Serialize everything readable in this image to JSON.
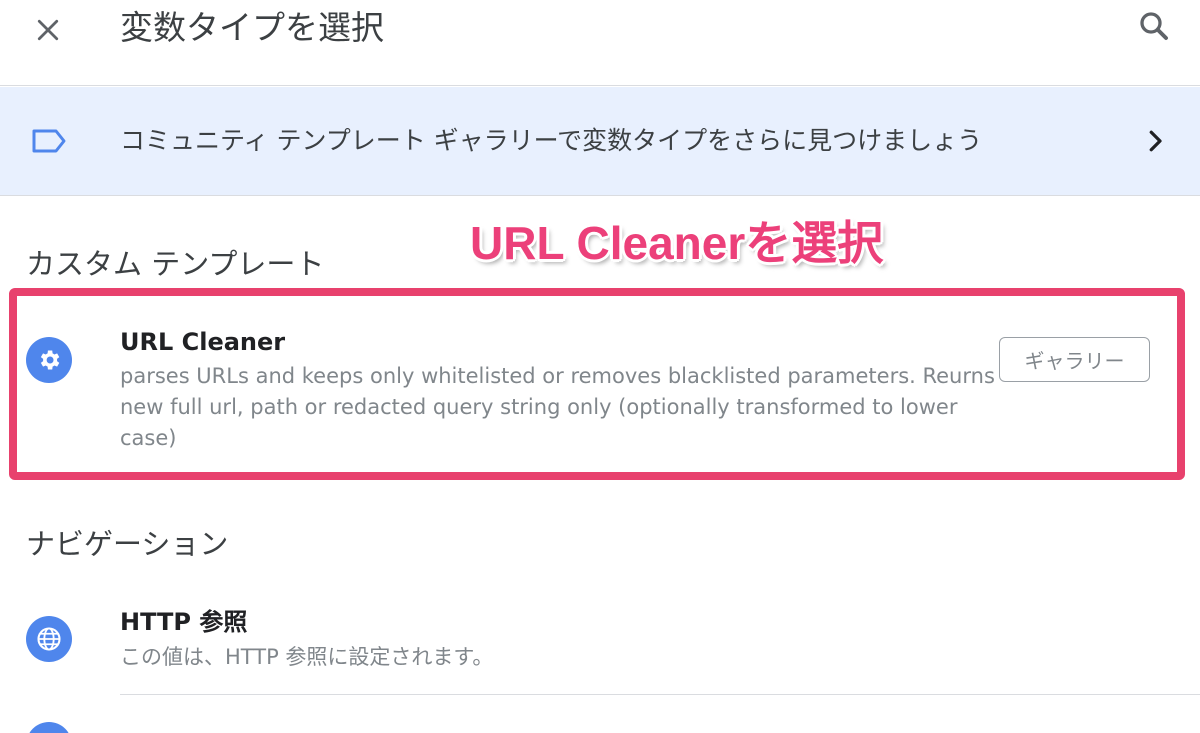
{
  "header": {
    "title": "変数タイプを選択",
    "close_icon": "close-icon",
    "search_icon": "search-icon"
  },
  "banner": {
    "text": "コミュニティ テンプレート ギャラリーで変数タイプをさらに見つけましょう",
    "tag_icon": "label-tag-icon",
    "chevron_icon": "chevron-right-icon"
  },
  "annotation": {
    "text": "URL Cleanerを選択",
    "color": "#e8416d"
  },
  "sections": {
    "custom_templates": {
      "title": "カスタム テンプレート",
      "items": [
        {
          "name": "URL Cleaner",
          "description": "parses URLs and keeps only whitelisted or removes blacklisted parameters. Reurns new full url, path or redacted query string only (optionally transformed to lower case)",
          "icon": "gear-icon",
          "gallery_label": "ギャラリー"
        }
      ]
    },
    "navigation": {
      "title": "ナビゲーション",
      "items": [
        {
          "name": "HTTP 参照",
          "description": "この値は、HTTP 参照に設定されます。",
          "icon": "globe-icon"
        }
      ]
    }
  },
  "colors": {
    "accent_blue": "#4f86ec",
    "banner_bg": "#e8f0fe",
    "highlight": "#e8416d"
  }
}
